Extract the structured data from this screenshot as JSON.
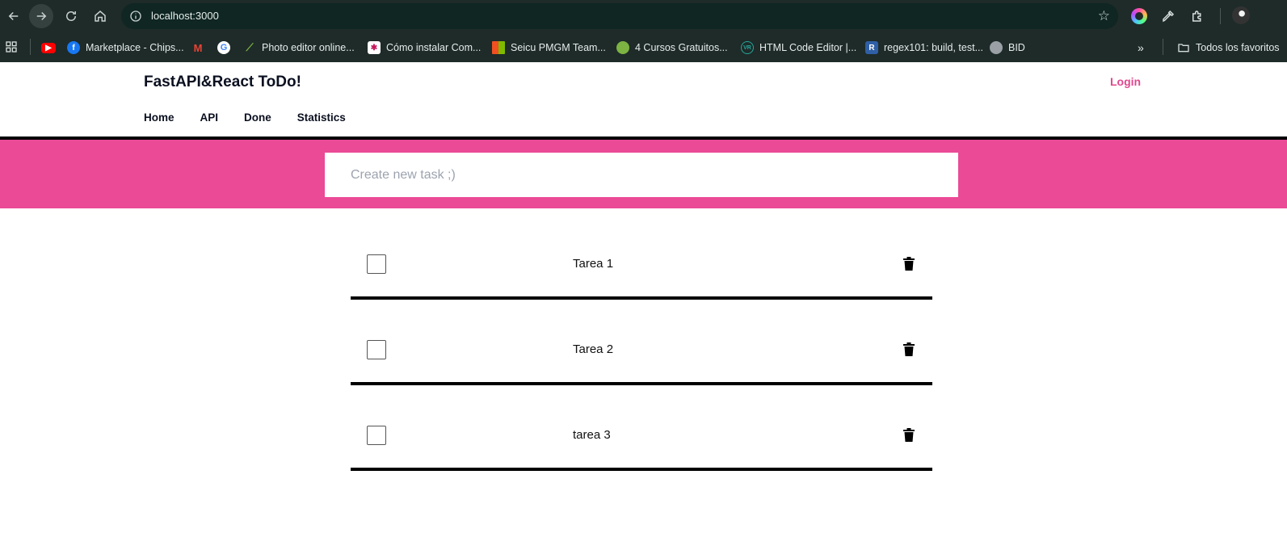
{
  "browser": {
    "url": "localhost:3000",
    "bookmarks": [
      {
        "label": "",
        "icon": "youtube-icon",
        "color": "#ff0000"
      },
      {
        "label": "Marketplace - Chips...",
        "icon": "facebook-icon",
        "color": "#1877f2"
      },
      {
        "label": "",
        "icon": "gmail-icon",
        "color": "#ea4335"
      },
      {
        "label": "",
        "icon": "google-icon",
        "color": "#4285f4"
      },
      {
        "label": "Photo editor online...",
        "icon": "brush-icon",
        "color": "#7cb342"
      },
      {
        "label": "Cómo instalar Com...",
        "icon": "compose-icon",
        "color": "#c2185b"
      },
      {
        "label": "Seicu PMGM Team...",
        "icon": "microsoft-icon",
        "color": "#f25022"
      },
      {
        "label": "4 Cursos Gratuitos...",
        "icon": "globe-leaf-icon",
        "color": "#7cb342"
      },
      {
        "label": "HTML Code Editor |...",
        "icon": "code-editor-icon",
        "color": "#26a69a"
      },
      {
        "label": "regex101: build, test...",
        "icon": "regex-icon",
        "color": "#2f5fa7"
      },
      {
        "label": "BID",
        "icon": "globe-icon",
        "color": "#9aa0a6"
      }
    ],
    "all_bookmarks": "Todos los favoritos"
  },
  "app": {
    "brand": "FastAPI&React ToDo!",
    "login": "Login",
    "menu": [
      "Home",
      "API",
      "Done",
      "Statistics"
    ],
    "input_placeholder": "Create new task ;)",
    "accent": "#eb4a97"
  },
  "tasks": [
    {
      "title": "Tarea 1",
      "done": false
    },
    {
      "title": "Tarea 2",
      "done": false
    },
    {
      "title": "tarea 3",
      "done": false
    }
  ]
}
